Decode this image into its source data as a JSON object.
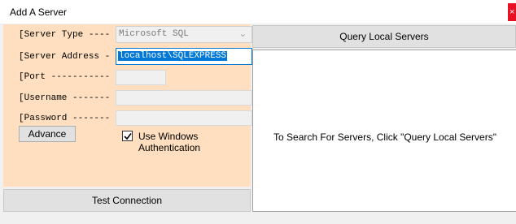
{
  "window": {
    "title": "Add A Server",
    "close_label": "×"
  },
  "form": {
    "server_type": {
      "label": "[Server Type ----",
      "value": "Microsoft SQL"
    },
    "server_address": {
      "label": "[Server Address -",
      "value": "localhost\\SQLEXPRESS"
    },
    "port": {
      "label": "[Port -----------",
      "value": ""
    },
    "username": {
      "label": "[Username -------",
      "value": ""
    },
    "password": {
      "label": "[Password -------",
      "value": ""
    },
    "advance_label": "Advance",
    "windows_auth": {
      "label": "Use Windows Authentication",
      "checked": true
    }
  },
  "buttons": {
    "test_connection": "Test Connection",
    "query_local_servers": "Query Local Servers"
  },
  "results": {
    "message": "To Search For Servers, Click \"Query Local Servers\""
  },
  "colors": {
    "panel_bg": "#ffdfbf",
    "selection": "#0078d7",
    "close": "#e81123"
  }
}
